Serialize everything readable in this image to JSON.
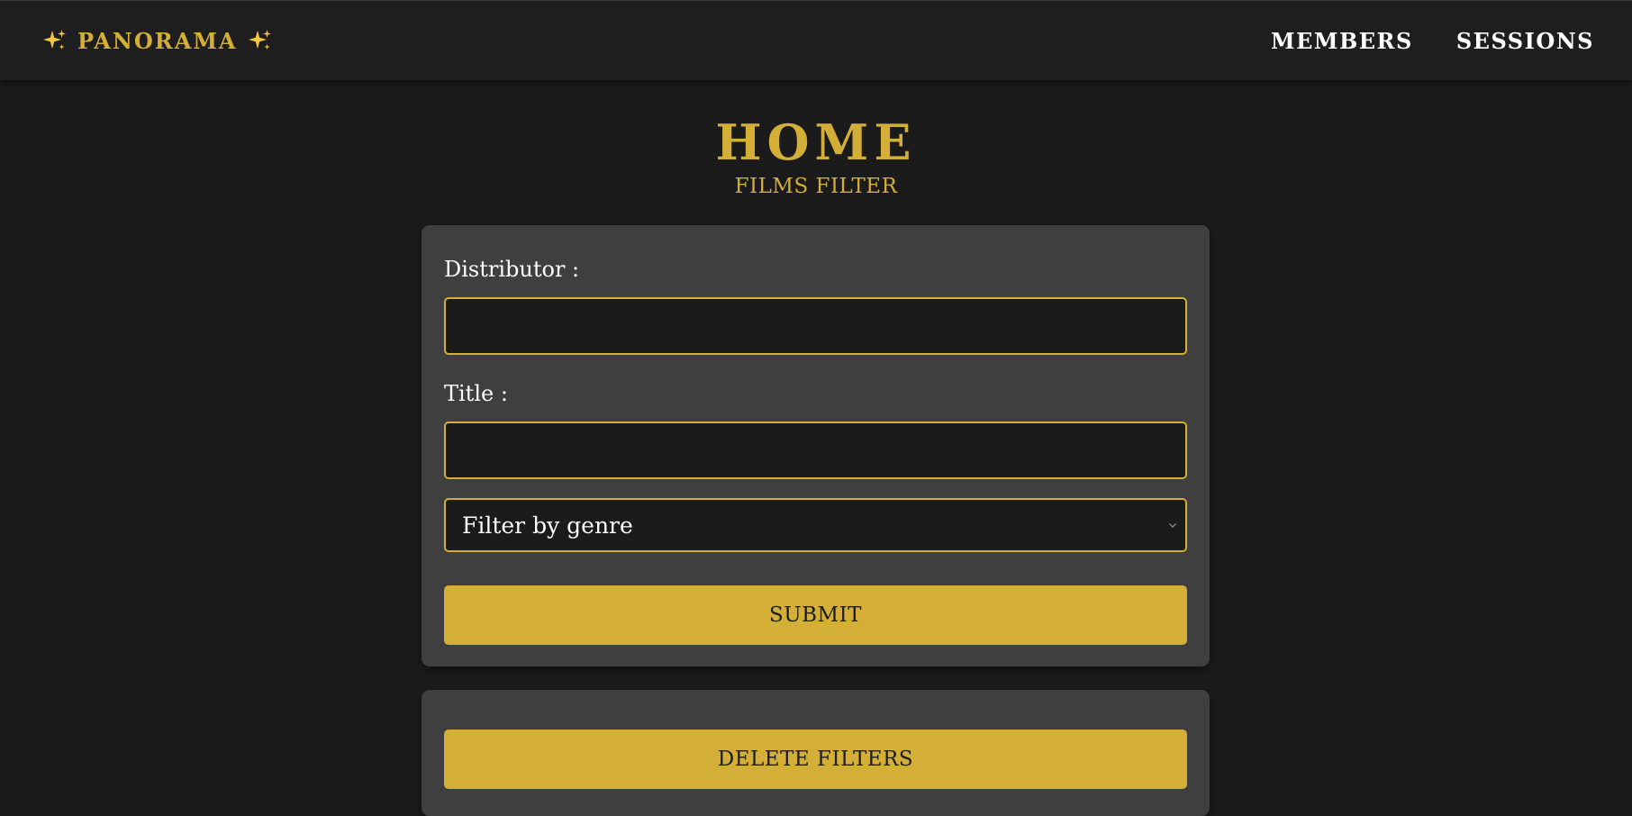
{
  "navbar": {
    "brand_label": "PANORAMA",
    "brand_icon": "sparkles-icon",
    "links": [
      {
        "label": "MEMBERS"
      },
      {
        "label": "SESSIONS"
      }
    ]
  },
  "header": {
    "title": "HOME",
    "subtitle": "FILMS FILTER"
  },
  "filter_form": {
    "distributor": {
      "label": "Distributor :",
      "value": ""
    },
    "title": {
      "label": "Title :",
      "value": ""
    },
    "genre_select": {
      "selected": "Filter by genre"
    },
    "submit_label": "SUBMIT"
  },
  "actions": {
    "delete_filters_label": "DELETE FILTERS"
  },
  "colors": {
    "accent": "#d4af37",
    "background": "#1b1b1b",
    "navbar": "#1e1e1e",
    "card": "#3f3f3f",
    "text": "#ffffff"
  }
}
